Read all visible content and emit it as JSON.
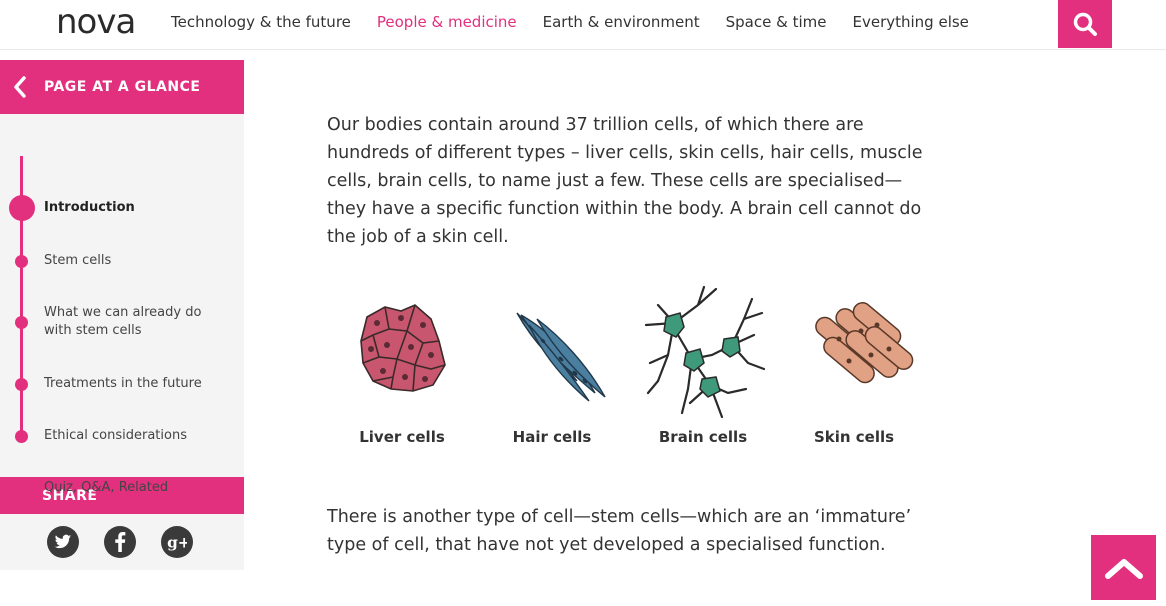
{
  "header": {
    "logo": "nova",
    "nav": [
      {
        "label": "Technology & the future",
        "active": false
      },
      {
        "label": "People & medicine",
        "active": true
      },
      {
        "label": "Earth & environment",
        "active": false
      },
      {
        "label": "Space & time",
        "active": false
      },
      {
        "label": "Everything else",
        "active": false
      }
    ],
    "search_icon": "search-icon"
  },
  "sidebar": {
    "title": "PAGE AT A GLANCE",
    "items": [
      {
        "label": "Introduction",
        "active": true
      },
      {
        "label": "Stem cells",
        "active": false
      },
      {
        "label": "What we can already do with stem cells",
        "active": false
      },
      {
        "label": "Treatments in the future",
        "active": false
      },
      {
        "label": "Ethical considerations",
        "active": false
      },
      {
        "label": "Quiz, Q&A, Related",
        "active": false
      }
    ],
    "share_title": "SHARE",
    "share_icons": [
      "twitter-icon",
      "facebook-icon",
      "google-plus-icon"
    ]
  },
  "main": {
    "paragraph1": "Our bodies contain around 37 trillion cells, of which there are hundreds of different types – liver cells, skin cells, hair cells, muscle cells, brain cells, to name just a few. These cells are specialised—they have a specific function within the body. A brain cell cannot do the job of a skin cell.",
    "cells": [
      {
        "label": "Liver cells",
        "color": "#c9566f"
      },
      {
        "label": "Hair cells",
        "color": "#4a7fa0"
      },
      {
        "label": "Brain cells",
        "color": "#3e9a7a"
      },
      {
        "label": "Skin cells",
        "color": "#e0a184"
      }
    ],
    "paragraph2": "There is another type of cell—stem cells—which are an ‘immature’ type of cell, that have not yet developed a specialised function."
  },
  "colors": {
    "accent": "#e2307f",
    "sidebar_bg": "#f4f4f4"
  }
}
